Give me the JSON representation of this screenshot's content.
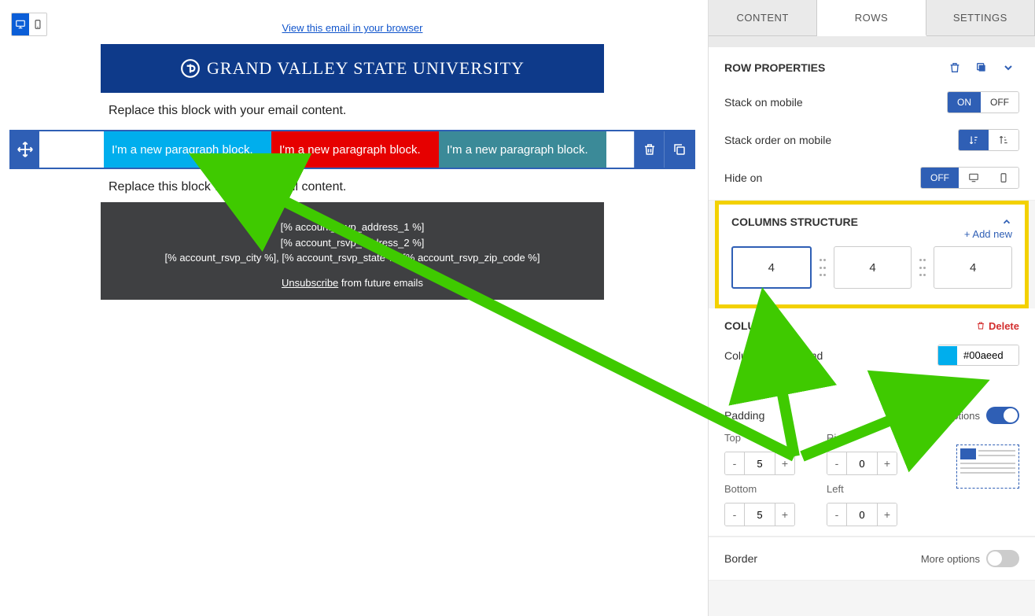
{
  "toolbar": {
    "view_link": "View this email in your browser"
  },
  "banner": {
    "text": "GRAND VALLEY STATE UNIVERSITY"
  },
  "content": {
    "replace1": "Replace this block with your email content.",
    "replace2": "Replace this block with your email content.",
    "col1": "I'm a new paragraph block.",
    "col2": "I'm a new paragraph block.",
    "col3": "I'm a new paragraph block."
  },
  "footer": {
    "addr1": "[% account_rsvp_address_1 %]",
    "addr2": "[% account_rsvp_address_2 %]",
    "city_line": "[% account_rsvp_city %], [% account_rsvp_state %] [% account_rsvp_zip_code %]",
    "unsubscribe": "Unsubscribe",
    "unsub_suffix": " from future emails"
  },
  "sidebar": {
    "tabs": {
      "content": "CONTENT",
      "rows": "ROWS",
      "settings": "SETTINGS"
    },
    "row_properties": "ROW PROPERTIES",
    "stack_mobile": "Stack on mobile",
    "stack_on": "ON",
    "stack_off": "OFF",
    "stack_order": "Stack order on mobile",
    "hide_on": "Hide on",
    "hide_off": "OFF",
    "cols_structure": "COLUMNS STRUCTURE",
    "add_new": "+  Add new",
    "col_vals": [
      "4",
      "4",
      "4"
    ],
    "column_n": "COLUMN 1",
    "delete": "Delete",
    "col_bg": "Column background",
    "color_val": "#00aeed",
    "padding": "Padding",
    "more_options": "More options",
    "top": "Top",
    "right": "Right",
    "bottom": "Bottom",
    "left": "Left",
    "pad_top": "5",
    "pad_right": "0",
    "pad_bottom": "5",
    "pad_left": "0",
    "border": "Border"
  }
}
